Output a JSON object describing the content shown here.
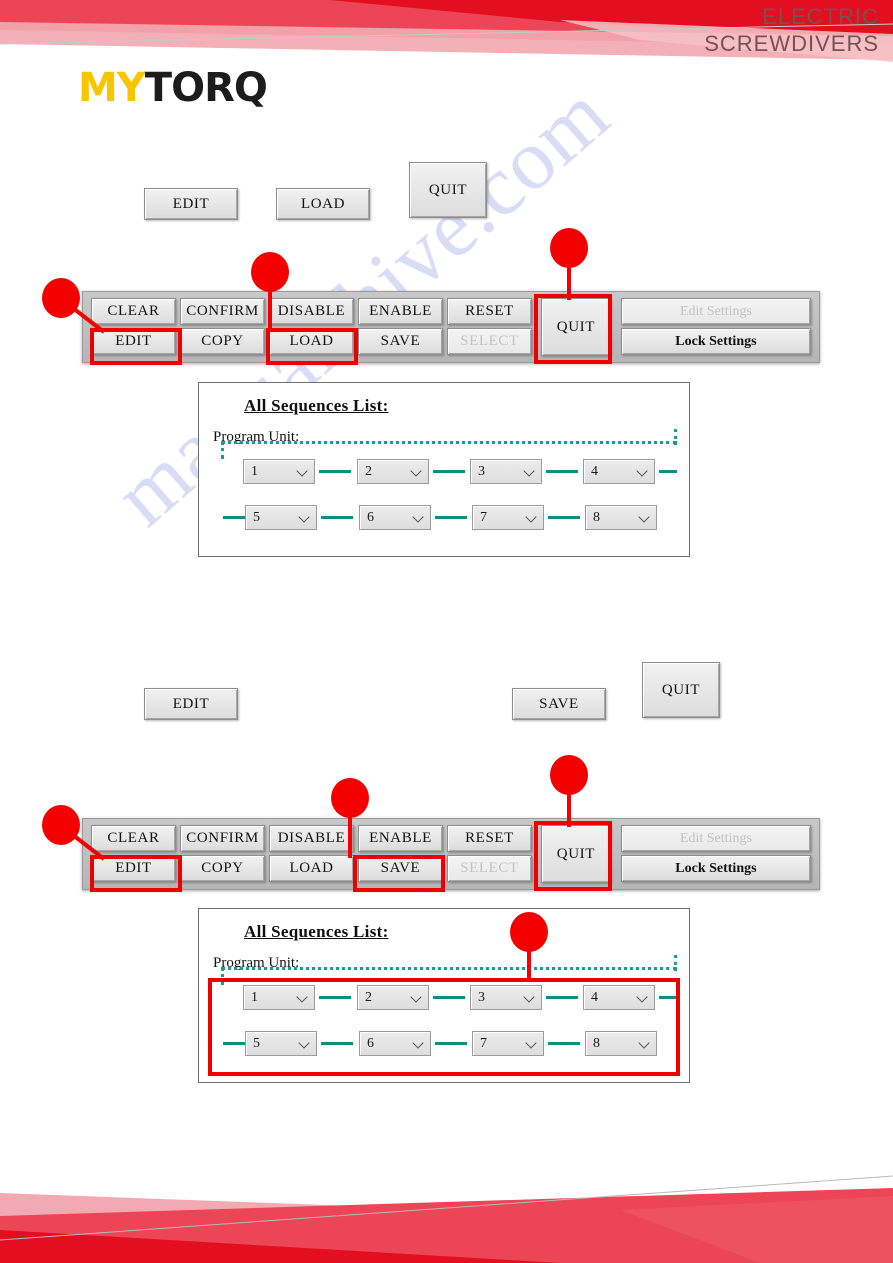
{
  "header": {
    "caption_line1": "ELECTRIC",
    "caption_line2": "SCREWDIVERS",
    "logo_part1": "MY",
    "logo_part2": "TORQ",
    "accent_red": "#e8303f",
    "accent_red_dark": "#e60f24",
    "accent_pink": "#f0a5ad",
    "logo_yellow": "#f7c600",
    "caption_color": "#7a5055"
  },
  "watermark": {
    "text": "manualshive.com",
    "color": "#b9c0ec"
  },
  "section_one": {
    "solo_buttons": [
      {
        "label": "EDIT"
      },
      {
        "label": "LOAD"
      },
      {
        "label": "QUIT"
      }
    ],
    "toolbar": {
      "row_top": [
        "CLEAR",
        "CONFIRM",
        "DISABLE",
        "ENABLE",
        "RESET"
      ],
      "row_bottom": [
        "EDIT",
        "COPY",
        "LOAD",
        "SAVE",
        "SELECT"
      ],
      "disabled_buttons": [
        "SELECT",
        "Edit Settings"
      ],
      "quit_label": "QUIT",
      "edit_settings_label": "Edit Settings",
      "lock_settings_label": "Lock Settings",
      "highlighted": [
        "EDIT",
        "LOAD",
        "QUIT"
      ]
    },
    "sequences": {
      "title": "All Sequences List:",
      "subtitle": "Program Unit:",
      "row1": [
        "1",
        "2",
        "3",
        "4"
      ],
      "row2": [
        "5",
        "6",
        "7",
        "8"
      ],
      "link_color": "#0d8f82",
      "outlined": false
    }
  },
  "section_two": {
    "solo_buttons": [
      {
        "label": "EDIT"
      },
      {
        "label": "SAVE"
      },
      {
        "label": "QUIT"
      }
    ],
    "toolbar": {
      "row_top": [
        "CLEAR",
        "CONFIRM",
        "DISABLE",
        "ENABLE",
        "RESET"
      ],
      "row_bottom": [
        "EDIT",
        "COPY",
        "LOAD",
        "SAVE",
        "SELECT"
      ],
      "disabled_buttons": [
        "SELECT",
        "Edit Settings"
      ],
      "quit_label": "QUIT",
      "edit_settings_label": "Edit Settings",
      "lock_settings_label": "Lock Settings",
      "highlighted": [
        "EDIT",
        "SAVE",
        "QUIT"
      ]
    },
    "sequences": {
      "title": "All Sequences List:",
      "subtitle": "Program Unit:",
      "row1": [
        "1",
        "2",
        "3",
        "4"
      ],
      "row2": [
        "5",
        "6",
        "7",
        "8"
      ],
      "link_color": "#0d8f82",
      "outlined": true
    }
  },
  "callout_color": "#f40000"
}
